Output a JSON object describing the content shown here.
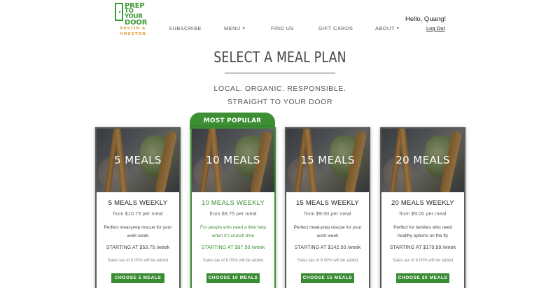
{
  "logo": {
    "line1": "PREP",
    "line2": "TO YOUR",
    "line3": "DOOR",
    "location_line1": "AUSTIN &",
    "location_line2": "HOUSTON",
    "brand_color": "#3d9b35",
    "accent_color": "#e39c39"
  },
  "nav": {
    "items": [
      {
        "label": "SUBSCRIBE",
        "has_caret": false
      },
      {
        "label": "MENU",
        "has_caret": true
      },
      {
        "label": "FIND US",
        "has_caret": false
      },
      {
        "label": "GIFT CARDS",
        "has_caret": false
      },
      {
        "label": "ABOUT",
        "has_caret": true
      }
    ],
    "greeting": "Hello, Quang!",
    "logout": "Log Out"
  },
  "page": {
    "title": "SELECT A MEAL PLAN",
    "subtitle_line1": "LOCAL. ORGANIC. RESPONSIBLE.",
    "subtitle_line2": "STRAIGHT TO YOUR DOOR"
  },
  "popular_label": "MOST POPULAR",
  "plans": [
    {
      "overlay": "5 MEALS",
      "name": "5 MEALS WEEKLY",
      "from": "from $10.75 per meal",
      "desc": "Perfect meal-prep rescue for your work week",
      "price": "STARTING AT $53.75 /week",
      "tax": "Sales tax of 8.00% will be added",
      "button": "CHOOSE 5 MEALS"
    },
    {
      "overlay": "10 MEALS",
      "name": "10 MEALS WEEKLY",
      "from": "from $9.75 per meal",
      "desc": "For people who need a little help when it's crunch time",
      "price": "STARTING AT $97.50 /week",
      "tax": "Sales tax of 8.00% will be added",
      "button": "CHOOSE 10 MEALS"
    },
    {
      "overlay": "15 MEALS",
      "name": "15 MEALS WEEKLY",
      "from": "from $9.50 per meal",
      "desc": "Perfect meal-prep rescue for your work week",
      "price": "STARTING AT $142.50 /week",
      "tax": "Sales tax of 8.00% will be added",
      "button": "CHOOSE 15 MEALS"
    },
    {
      "overlay": "20 MEALS",
      "name": "20 MEALS WEEKLY",
      "from": "from $9.00 per meal",
      "desc": "Perfect for families who need healthy options on the fly",
      "price": "STARTING AT $179.99 /week",
      "tax": "Sales tax of 8.00% will be added",
      "button": "CHOOSE 20 MEALS"
    }
  ],
  "colors": {
    "primary_green": "#3a8c34",
    "text_dark": "#333333"
  }
}
